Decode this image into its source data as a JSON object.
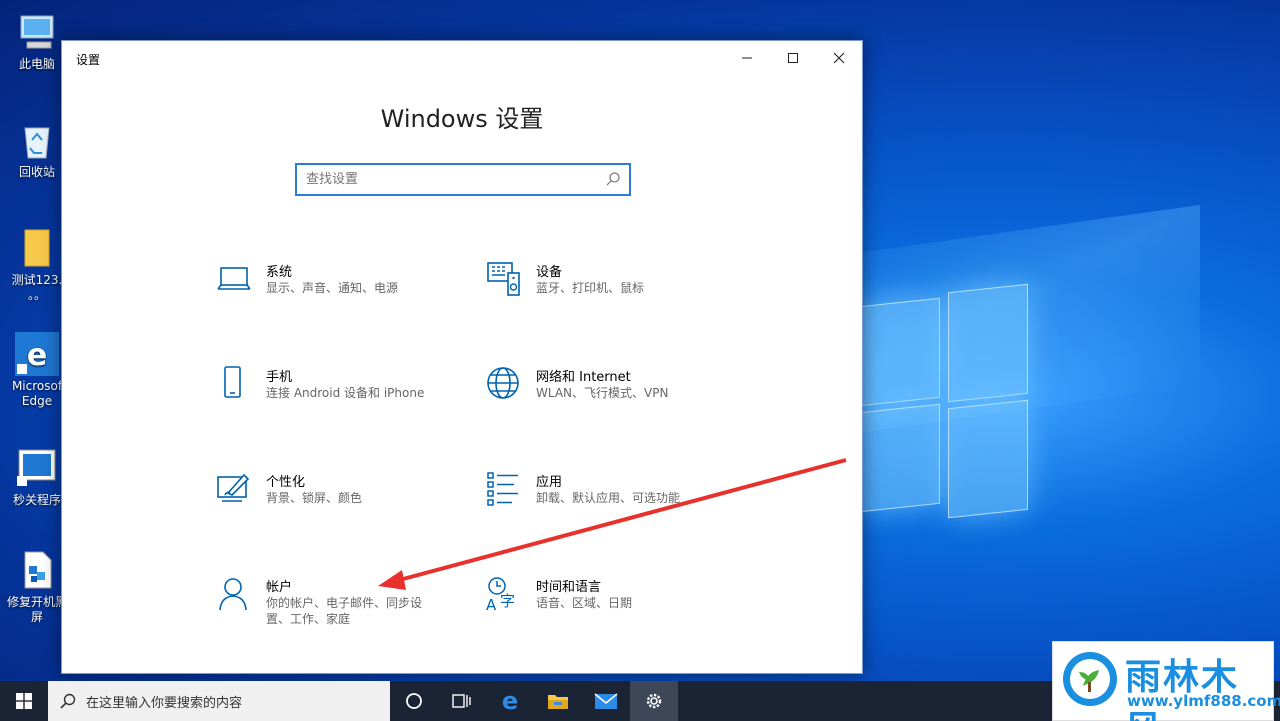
{
  "desktop": {
    "icons": [
      {
        "label": "此电脑",
        "icon": "computer-icon"
      },
      {
        "label": "回收站",
        "icon": "recycle-bin-icon"
      },
      {
        "label": "测试123.",
        "label2": "。。",
        "icon": "folder-icon"
      },
      {
        "label": "Microsof",
        "label2": "Edge",
        "icon": "edge-icon"
      },
      {
        "label": "秒关程序",
        "icon": "program-icon"
      },
      {
        "label": "修复开机黑",
        "label2": "屏",
        "icon": "repair-icon"
      }
    ]
  },
  "window": {
    "title": "设置",
    "heading": "Windows 设置",
    "search_placeholder": "查找设置",
    "items": [
      {
        "name": "系统",
        "desc": "显示、声音、通知、电源",
        "icon": "laptop-icon"
      },
      {
        "name": "设备",
        "desc": "蓝牙、打印机、鼠标",
        "icon": "devices-icon"
      },
      {
        "name": "手机",
        "desc": "连接 Android 设备和 iPhone",
        "icon": "phone-icon"
      },
      {
        "name": "网络和 Internet",
        "desc": "WLAN、飞行模式、VPN",
        "icon": "globe-icon"
      },
      {
        "name": "个性化",
        "desc": "背景、锁屏、颜色",
        "icon": "personalize-icon"
      },
      {
        "name": "应用",
        "desc": "卸载、默认应用、可选功能",
        "icon": "apps-icon"
      },
      {
        "name": "帐户",
        "desc": "你的帐户、电子邮件、同步设置、工作、家庭",
        "icon": "person-icon"
      },
      {
        "name": "时间和语言",
        "desc": "语音、区域、日期",
        "icon": "time-language-icon"
      }
    ]
  },
  "taskbar": {
    "search_text": "在这里输入你要搜索的内容"
  },
  "watermark": {
    "title": "雨林木风",
    "url": "www.ylmf888.com"
  },
  "colors": {
    "accent": "#0063b1",
    "search_border": "#2a7fd4",
    "annotation": "#e8302c"
  }
}
